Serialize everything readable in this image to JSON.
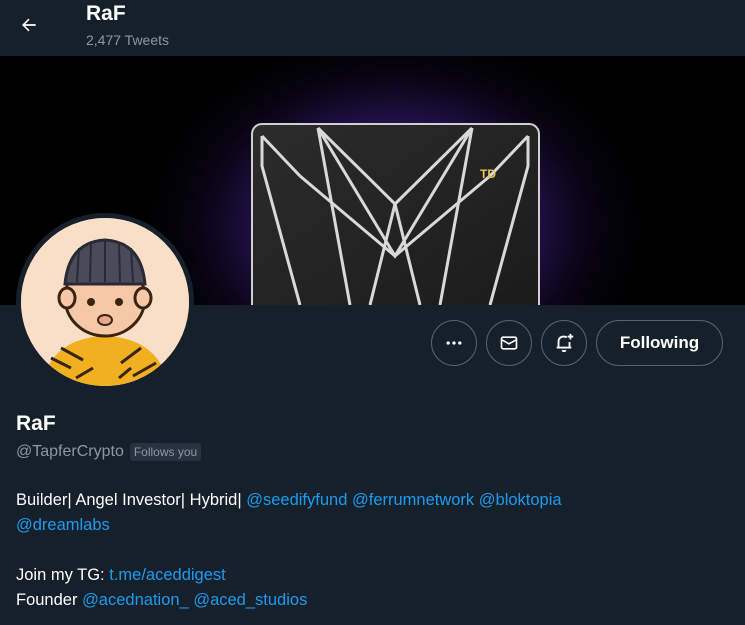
{
  "header": {
    "title": "RaF",
    "tweet_count": "2,477 Tweets"
  },
  "banner": {
    "card_badge": "TD"
  },
  "actions": {
    "following_label": "Following"
  },
  "profile": {
    "display_name": "RaF",
    "handle": "@TapferCrypto",
    "follows_you": "Follows you"
  },
  "bio": {
    "line1_text": "Builder| Angel Investor| Hybrid|",
    "line1_links": [
      "@seedifyfund",
      "@ferrumnetwork",
      "@bloktopia"
    ],
    "line2_links": [
      "@dreamlabs"
    ],
    "line3_text": "Join my TG:",
    "line3_link": "t.me/aceddigest",
    "line4_text": "Founder",
    "line4_links": [
      "@acednation_",
      "@aced_studios"
    ]
  },
  "colors": {
    "background": "#15202b",
    "link": "#1d9bf0",
    "muted": "#8b98a5"
  }
}
